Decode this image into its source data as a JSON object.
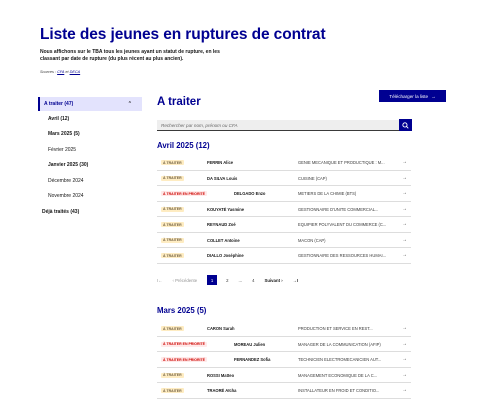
{
  "page": {
    "title": "Liste des jeunes en ruptures de contrat",
    "intro": "Nous affichons sur le TBA tous les jeunes ayant un statut de rupture, en les classant par date de rupture (du plus récent au plus ancien).",
    "sources_prefix": "Sources :",
    "sources_a": "CFA",
    "sources_and": "et",
    "sources_b": "DECA",
    "download_label": "Télécharger la liste",
    "download_icon": "→"
  },
  "sidebar": {
    "top_label": "A traiter (47)",
    "top_chevron": "⌃",
    "items": [
      {
        "label": "Avril (12)",
        "bold": true
      },
      {
        "label": "Mars 2025 (5)",
        "bold": true
      },
      {
        "label": "Février 2025",
        "bold": false
      },
      {
        "label": "Janvier 2025 (30)",
        "bold": true
      },
      {
        "label": "Décembre 2024",
        "bold": false
      },
      {
        "label": "Novembre 2024",
        "bold": false
      }
    ],
    "done_label": "Déjà traités (43)"
  },
  "main": {
    "heading": "A traiter",
    "search_placeholder": "Rechercher par nom, prénom ou CFA",
    "search_icon": "search-icon",
    "row_arrow": "→",
    "sections": [
      {
        "title": "Avril 2025 (12)",
        "rows": [
          {
            "badge": "À TRAITER",
            "type": "warn",
            "name": "FERRIN Alice",
            "formation": "GENIE MECANIQUE ET PRODUCTIQUE : M..."
          },
          {
            "badge": "À TRAITER",
            "type": "warn",
            "name": "DA SILVA Louis",
            "formation": "CUISINE (CAP)"
          },
          {
            "badge": "À TRAITER EN PRIORITÉ",
            "type": "err",
            "name": "DELGADO Enzo",
            "formation": "METIERS DE LA CHIMIE (BTS)"
          },
          {
            "badge": "À TRAITER",
            "type": "warn",
            "name": "KOUYATÉ Yasmine",
            "formation": "GESTIONNAIRE D'UNITE COMMERCIAL..."
          },
          {
            "badge": "À TRAITER",
            "type": "warn",
            "name": "REYNAUD Zoé",
            "formation": "EQUIPIER POLYVALENT DU COMMERCE (C..."
          },
          {
            "badge": "À TRAITER",
            "type": "warn",
            "name": "COLLET Antoine",
            "formation": "MACON (CAP)"
          },
          {
            "badge": "À TRAITER",
            "type": "warn",
            "name": "DIALLO Joséphine",
            "formation": "GESTIONNAIRE DES RESSOURCES HUMAI..."
          }
        ]
      },
      {
        "title": "Mars 2025 (5)",
        "rows": [
          {
            "badge": "À TRAITER",
            "type": "warn",
            "name": "CARON Sarah",
            "formation": "PRODUCTION ET SERVICE EN REST..."
          },
          {
            "badge": "À TRAITER EN PRIORITÉ",
            "type": "err",
            "name": "MOREAU Julien",
            "formation": "MANAGER DE LA COMMUNICATION (AFIP)"
          },
          {
            "badge": "À TRAITER EN PRIORITÉ",
            "type": "err",
            "name": "FERNANDEZ Sofia",
            "formation": "TECHNICIEN ELECTROMECANICIEN AUT..."
          },
          {
            "badge": "À TRAITER",
            "type": "warn",
            "name": "ROSSI Matteo",
            "formation": "MANAGEMENT ECONOMIQUE DE LA C..."
          },
          {
            "badge": "À TRAITER",
            "type": "warn",
            "name": "TRAORÉ Aïcha",
            "formation": "INSTALLATEUR EN FROID ET CONDITIO..."
          }
        ]
      }
    ],
    "pagination": {
      "first": "I←",
      "prev": "‹ Précédente",
      "pages": [
        "1",
        "2",
        "...",
        "4"
      ],
      "current": "1",
      "next": "Suivant ›",
      "last": "→I"
    }
  },
  "colors": {
    "primary": "#000091",
    "warn_bg": "#feecc2",
    "warn_text": "#716043",
    "error_bg": "#ffe9e9",
    "error_text": "#ce0500",
    "sidebar_active_bg": "#e3e3fd"
  }
}
